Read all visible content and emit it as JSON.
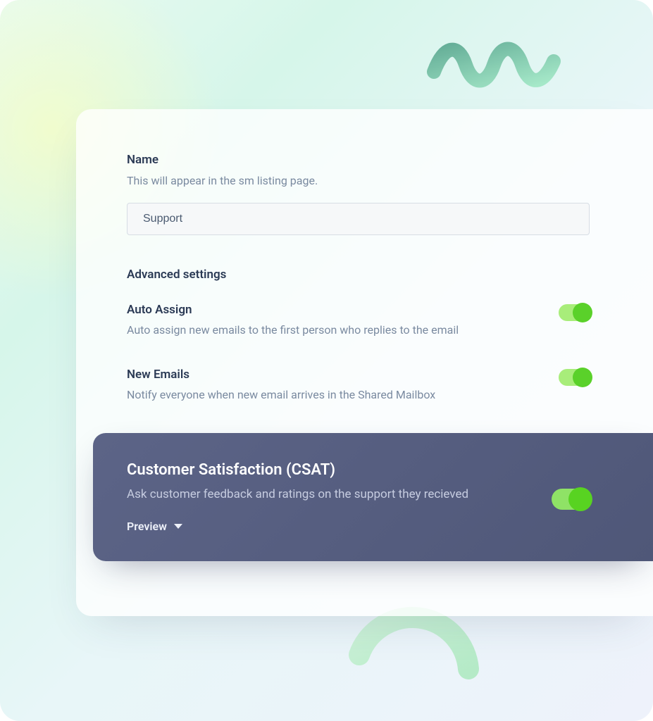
{
  "name_section": {
    "label": "Name",
    "helper": "This will appear in the sm listing page.",
    "value": "Support"
  },
  "advanced_heading": "Advanced settings",
  "settings": {
    "auto_assign": {
      "title": "Auto Assign",
      "desc": "Auto assign new emails to the first person who replies to the email",
      "on": true
    },
    "new_emails": {
      "title": "New Emails",
      "desc": "Notify everyone when new email arrives in the Shared Mailbox",
      "on": true
    }
  },
  "csat": {
    "title": "Customer Satisfaction (CSAT)",
    "desc": "Ask customer feedback and ratings on the support they recieved",
    "on": true,
    "preview_label": "Preview"
  },
  "colors": {
    "accent_green": "#58d321",
    "panel_dark": "#545c7f"
  }
}
